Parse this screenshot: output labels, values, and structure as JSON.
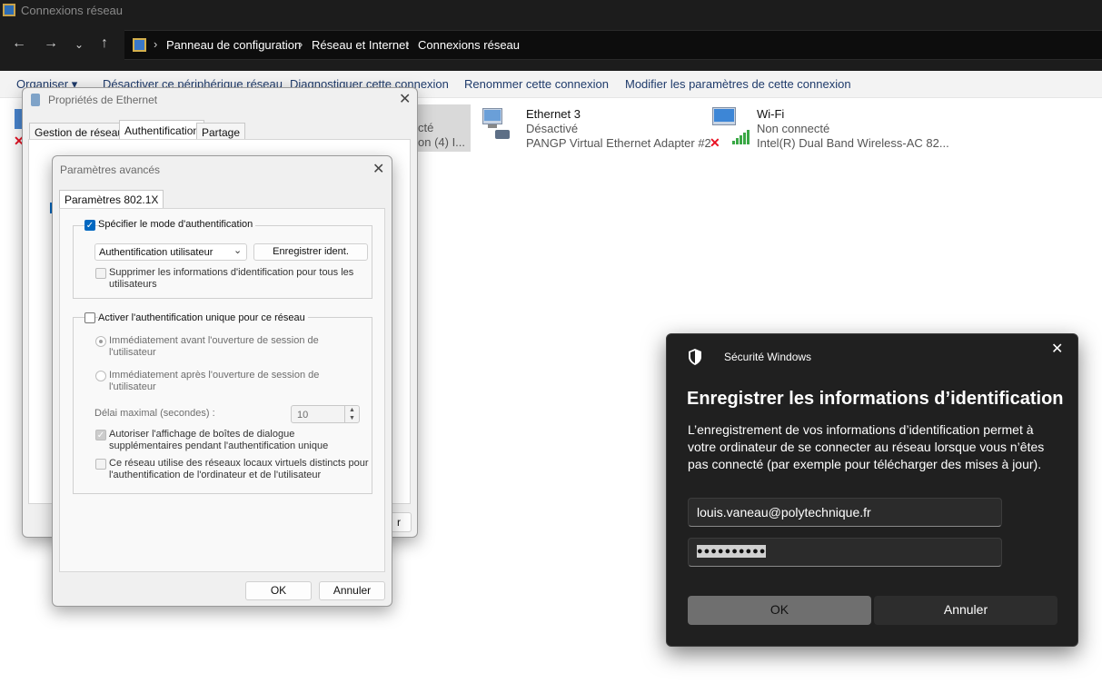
{
  "window": {
    "title": "Connexions réseau"
  },
  "breadcrumb": [
    "Panneau de configuration",
    "Réseau et Internet",
    "Connexions réseau"
  ],
  "commandbar": {
    "organize": "Organiser ▾",
    "disable": "Désactiver ce périphérique réseau",
    "diagnose": "Diagnostiquer cette connexion",
    "rename": "Renommer cette connexion",
    "modify": "Modifier les paramètres de cette connexion"
  },
  "network_items": [
    {
      "name": "",
      "status": "cté",
      "adapter": "on (4) I..."
    },
    {
      "name": "Ethernet 3",
      "status": "Désactivé",
      "adapter": "PANGP Virtual Ethernet Adapter #2"
    },
    {
      "name": "Wi-Fi",
      "status": "Non connecté",
      "adapter": "Intel(R) Dual Band Wireless-AC 82..."
    }
  ],
  "ethernet_props": {
    "title": "Propriétés de Ethernet",
    "tabs": [
      "Gestion de réseau",
      "Authentification",
      "Partage"
    ],
    "partial_button": "r"
  },
  "advanced": {
    "title": "Paramètres avancés",
    "tab": "Paramètres 802.1X",
    "specify_mode": "Spécifier le mode d'authentification",
    "auth_mode_value": "Authentification utilisateur",
    "save_credentials": "Enregistrer ident.",
    "delete_credentials": "Supprimer les informations d'identification pour tous les utilisateurs",
    "sso_enable": "Activer l'authentification unique pour ce réseau",
    "sso_before": "Immédiatement avant l'ouverture de session de l'utilisateur",
    "sso_after": "Immédiatement après l'ouverture de session de l'utilisateur",
    "max_delay_label": "Délai maximal (secondes) :",
    "max_delay_value": "10",
    "allow_dialogs": "Autoriser l'affichage de boîtes de dialogue supplémentaires pendant l'authentification unique",
    "vlan": "Ce réseau utilise des réseaux locaux virtuels distincts pour l'authentification de l'ordinateur et de l'utilisateur",
    "ok": "OK",
    "cancel": "Annuler"
  },
  "security": {
    "header": "Sécurité Windows",
    "title": "Enregistrer les informations d’identification",
    "body": "L’enregistrement de vos informations d’identification permet à votre ordinateur de se connecter au réseau lorsque vous n’êtes pas connecté (par exemple pour télécharger des mises à jour).",
    "username": "louis.vaneau@polytechnique.fr",
    "password_mask": "●●●●●●●●●●",
    "ok": "OK",
    "cancel": "Annuler"
  },
  "colors": {
    "accent": "#0067c0",
    "dark_bg": "#202020",
    "error_red": "#e81123"
  }
}
